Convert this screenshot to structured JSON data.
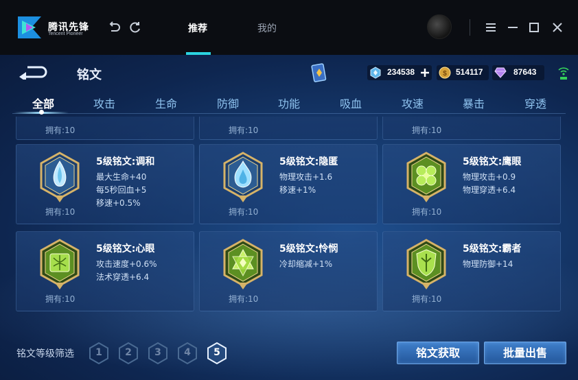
{
  "launcher": {
    "logo_text": "腾讯先锋",
    "logo_sub": "Tencent Pioneer",
    "tabs": [
      {
        "label": "推荐",
        "active": true
      },
      {
        "label": "我的",
        "active": false
      }
    ]
  },
  "game": {
    "title": "铭文",
    "currencies": [
      {
        "icon": "crystal-icon",
        "value": "234538"
      },
      {
        "icon": "gold-coin-icon",
        "value": "514117"
      },
      {
        "icon": "diamond-icon",
        "value": "87643"
      }
    ],
    "categories": [
      "全部",
      "攻击",
      "生命",
      "防御",
      "功能",
      "吸血",
      "攻速",
      "暴击",
      "穿透"
    ],
    "active_category": "全部",
    "top_row_owned": [
      "拥有:10",
      "拥有:10",
      "拥有:10"
    ],
    "runes": [
      {
        "name": "5级铭文:调和",
        "attrs": [
          "最大生命+40",
          "每5秒回血+5",
          "移速+0.5%"
        ],
        "owned": "拥有:10",
        "color": "blue",
        "symbol": "drop"
      },
      {
        "name": "5级铭文:隐匿",
        "attrs": [
          "物理攻击+1.6",
          "移速+1%"
        ],
        "owned": "拥有:10",
        "color": "blue",
        "symbol": "flame"
      },
      {
        "name": "5级铭文:鹰眼",
        "attrs": [
          "物理攻击+0.9",
          "物理穿透+6.4"
        ],
        "owned": "拥有:10",
        "color": "green",
        "symbol": "clover"
      },
      {
        "name": "5级铭文:心眼",
        "attrs": [
          "攻击速度+0.6%",
          "法术穿透+6.4"
        ],
        "owned": "拥有:10",
        "color": "green",
        "symbol": "wings"
      },
      {
        "name": "5级铭文:怜悯",
        "attrs": [
          "冷却缩减+1%"
        ],
        "owned": "拥有:10",
        "color": "green",
        "symbol": "star"
      },
      {
        "name": "5级铭文:霸者",
        "attrs": [
          "物理防御+14"
        ],
        "owned": "拥有:10",
        "color": "green",
        "symbol": "shield"
      }
    ],
    "filter_label": "铭文等级筛选",
    "levels": [
      "1",
      "2",
      "3",
      "4",
      "5"
    ],
    "active_level": "5",
    "buttons": {
      "obtain": "铭文获取",
      "bulk_sell": "批量出售"
    },
    "colors": {
      "accent": "#2bd3e0",
      "button": "#2f6bb5",
      "gold": "#c9a65a",
      "rune_blue": "#7fd0f0",
      "rune_green": "#7ec23a"
    }
  }
}
